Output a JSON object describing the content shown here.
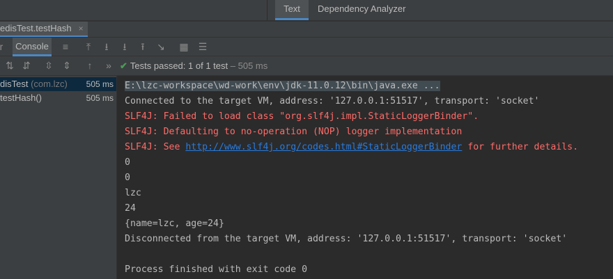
{
  "editor_tabs": {
    "text": "Text",
    "dependency": "Dependency Analyzer"
  },
  "run_tab": {
    "label": "edisTest.testHash",
    "close": "×"
  },
  "toolbar": {
    "console_label": "Console",
    "left_partial": "r"
  },
  "test_status": {
    "label": "Tests passed:",
    "count": "1",
    "suffix": "of 1 test",
    "duration": "– 505 ms"
  },
  "tree": [
    {
      "name": "disTest",
      "pkg": "(com.lzc)",
      "duration": "505 ms"
    },
    {
      "name": "testHash()",
      "duration": "505 ms"
    }
  ],
  "console": {
    "cmd": "E:\\lzc-workspace\\wd-work\\env\\jdk-11.0.12\\bin\\java.exe ...",
    "connected": "Connected to the target VM, address: '127.0.0.1:51517', transport: 'socket'",
    "err1": "SLF4J: Failed to load class \"org.slf4j.impl.StaticLoggerBinder\".",
    "err2": "SLF4J: Defaulting to no-operation (NOP) logger implementation",
    "err3_pre": "SLF4J: See ",
    "err3_link": "http://www.slf4j.org/codes.html#StaticLoggerBinder",
    "err3_post": " for further details.",
    "out": [
      "0",
      "0",
      "lzc",
      "24",
      "{name=lzc, age=24}"
    ],
    "disconnected": "Disconnected from the target VM, address: '127.0.0.1:51517', transport: 'socket'",
    "finished": "Process finished with exit code 0"
  },
  "colors": {
    "error": "#ff6b68",
    "link": "#287bde",
    "pass": "#499c54",
    "accent": "#4a88c7"
  }
}
